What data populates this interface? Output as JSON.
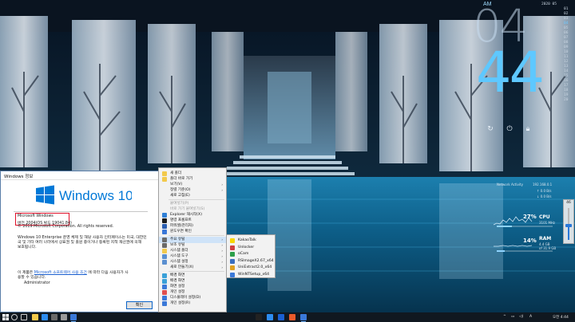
{
  "calendar": {
    "month_label": "2020 05",
    "days": [
      "01",
      "02",
      "03",
      "04",
      "05",
      "06",
      "07",
      "08",
      "09",
      "10",
      "11",
      "12",
      "13",
      "14",
      "15",
      "16",
      "17",
      "18",
      "19",
      "20"
    ],
    "active_day": "04"
  },
  "clock": {
    "ampm": "AM",
    "hour": "04",
    "minute": "44"
  },
  "power_icons": [
    "refresh-icon",
    "power-icon",
    "lock-icon"
  ],
  "monitor": {
    "title": "Network Activity",
    "ip": "192.168.0.1",
    "net_up": "↑ 0.0 B/s",
    "net_down": "↓ 0.0 B/s",
    "cpu_percent": "27%",
    "cpu_label": "CPU",
    "cpu_freq": "3101 MHz",
    "ram_percent": "14%",
    "ram_label": "RAM",
    "ram_used": "4.4 GB",
    "ram_total": "of 31.9 GB",
    "cpu_fill": 0.27,
    "ram_fill": 0.14,
    "volume_value": "46",
    "volume_level": 0.46
  },
  "about": {
    "title": "Windows 정보",
    "logo_text": "Windows 10",
    "lines": [
      "Microsoft Windows",
      "버전 2004(OS 빌드 19041.84)",
      "© 2019 Microsoft Corporation. All rights reserved.",
      "Windows 10 Enterprise 운영 체제 및 해당 사용자 인터페이스는 미국, 대한민",
      "국 및 기타 여러 나라에서 상표권 및 출원 중이거나 등록된 지적 재산권에 의해",
      "보호됩니다.",
      "이 제품은",
      "에 따라 다음 사용자가 사",
      "용할 수 있습니다.",
      "Administrator"
    ],
    "license_link": "Microsoft 소프트웨어 사용 조건",
    "ok_button": "확인"
  },
  "context_menu": {
    "items": [
      {
        "label": "새 폴더",
        "icon": "new-folder-icon",
        "color": "#f2c94c",
        "type": "item"
      },
      {
        "label": "폴더 바로 가기",
        "icon": "folder-shortcut-icon",
        "color": "#f2c94c",
        "type": "item"
      },
      {
        "label": "보기(V)",
        "type": "submenu"
      },
      {
        "label": "정렬 기준(O)",
        "type": "submenu"
      },
      {
        "label": "새로 고침(E)",
        "type": "item"
      },
      {
        "type": "separator"
      },
      {
        "label": "붙여넣기(P)",
        "type": "disabled"
      },
      {
        "label": "바로 가기 붙여넣기(S)",
        "type": "disabled"
      },
      {
        "label": "Explorer 재시작(X)",
        "icon": "explorer-restart-icon",
        "color": "#2f7fd6",
        "type": "item"
      },
      {
        "label": "명령 프롬프트",
        "icon": "cmd-icon",
        "color": "#1b1b1b",
        "type": "item"
      },
      {
        "label": "파워셸(관리자)",
        "icon": "powershell-icon",
        "color": "#2a5db0",
        "type": "item"
      },
      {
        "label": "윈도우면 확인",
        "icon": "windows-version-icon",
        "color": "#3a78d8",
        "type": "item"
      },
      {
        "type": "separator"
      },
      {
        "label": "주요 유틸",
        "icon": "utilities-icon",
        "color": "#6a6a6a",
        "type": "hover-submenu"
      },
      {
        "label": "보조 유틸",
        "icon": "sub-utilities-icon",
        "color": "#6a6a6a",
        "type": "submenu"
      },
      {
        "label": "시스템 폴더",
        "icon": "system-folder-icon",
        "color": "#f2c94c",
        "type": "submenu"
      },
      {
        "label": "시스템 도구",
        "icon": "system-tools-icon",
        "color": "#5a8fd0",
        "type": "submenu"
      },
      {
        "label": "시스템 설정",
        "icon": "system-settings-icon",
        "color": "#5a8fd0",
        "type": "submenu"
      },
      {
        "label": "새로 만들기(X)",
        "type": "submenu"
      },
      {
        "type": "separator"
      },
      {
        "label": "배경 화면",
        "icon": "wallpaper-icon",
        "color": "#3aa0d8",
        "type": "item"
      },
      {
        "label": "배경 화면",
        "icon": "wallpaper2-icon",
        "color": "#3aa0d8",
        "type": "item"
      },
      {
        "label": "화면 설정",
        "icon": "display-settings-icon",
        "color": "#3a78d8",
        "type": "item"
      },
      {
        "label": "개인 설정",
        "icon": "personalize-icon",
        "color": "#e05050",
        "type": "item"
      },
      {
        "label": "디스플레이 설정(D)",
        "icon": "display-icon",
        "color": "#3a78d8",
        "type": "item"
      },
      {
        "label": "개인 설정(R)",
        "icon": "personal-icon",
        "color": "#3a78d8",
        "type": "item"
      }
    ]
  },
  "submenu": {
    "items": [
      {
        "label": "KakaoTalk",
        "icon": "kakaotalk-icon",
        "color": "#f7d600"
      },
      {
        "label": "Unlocker",
        "icon": "unlocker-icon",
        "color": "#d04040"
      },
      {
        "label": "oCam",
        "icon": "ocam-icon",
        "color": "#2c9f4a"
      },
      {
        "label": "RSImageX2.67_x64",
        "icon": "rsimagex-icon",
        "color": "#3a6fc0"
      },
      {
        "label": "UniExtract2.0_x64",
        "icon": "uniextract-icon",
        "color": "#e0a020"
      },
      {
        "label": "WinNTSetup_x64",
        "icon": "winntsetup-icon",
        "color": "#3a78d8"
      }
    ]
  },
  "taskbar": {
    "ime": "A",
    "lang": "ENG",
    "time": "오전 4:44",
    "apps": [
      {
        "icon": "explorer-icon",
        "color": "#f2c94c"
      },
      {
        "icon": "edge-icon",
        "color": "#2d8cf0"
      },
      {
        "icon": "store-icon",
        "color": "#6a6a6a"
      },
      {
        "icon": "settings-icon",
        "color": "#9a9a9a"
      },
      {
        "icon": "about-window-icon",
        "color": "#3a78d8"
      }
    ]
  }
}
